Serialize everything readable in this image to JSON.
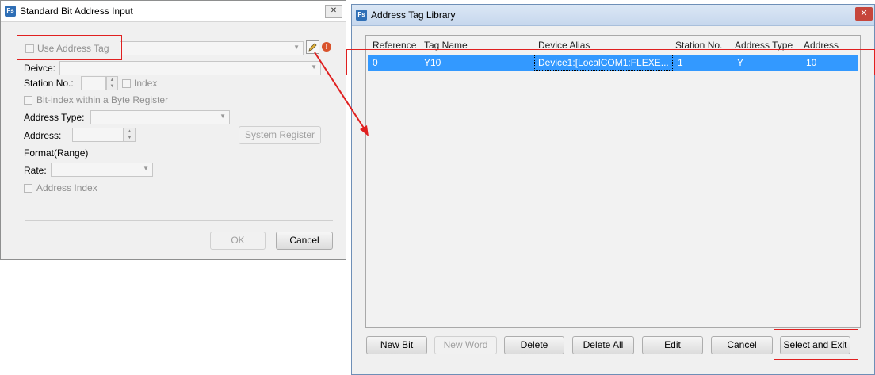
{
  "left_dialog": {
    "title": "Standard Bit Address Input",
    "use_address_tag": "Use Address Tag",
    "device_label": "Deivce:",
    "station_label": "Station No.:",
    "index_label": "Index",
    "bit_index_label": "Bit-index within a Byte Register",
    "address_type_label": "Address Type:",
    "address_label": "Address:",
    "system_register_button": "System Register",
    "format_label": "Format(Range)",
    "rate_label": "Rate:",
    "address_index_label": "Address Index",
    "ok_button": "OK",
    "cancel_button": "Cancel",
    "close_glyph": "✕"
  },
  "right_window": {
    "title": "Address Tag Library",
    "columns": [
      "Reference",
      "Tag Name",
      "Device Alias",
      "Station No.",
      "Address Type",
      "Address"
    ],
    "rows": [
      {
        "reference": "0",
        "tag_name": "Y10",
        "device_alias": "Device1:[LocalCOM1:FLEXE...",
        "station": "1",
        "address_type": "Y",
        "address": "10"
      }
    ],
    "buttons": {
      "new_bit": "New Bit",
      "new_word": "New Word",
      "delete": "Delete",
      "delete_all": "Delete All",
      "edit": "Edit",
      "cancel": "Cancel",
      "select_exit": "Select and Exit"
    },
    "close_glyph": "✕"
  },
  "app_icon_text": "Fs",
  "colors": {
    "highlight": "#e02020",
    "selection": "#3399ff"
  }
}
